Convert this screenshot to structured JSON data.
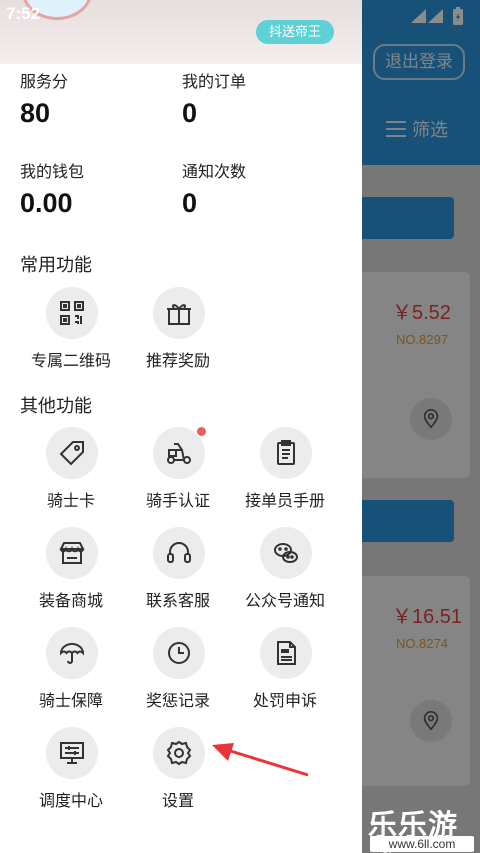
{
  "status_bar": {
    "time": "7:52"
  },
  "background": {
    "logout_label": "退出登录",
    "filter_label": "筛选",
    "orders": [
      {
        "price": "￥5.52",
        "order_no": "NO.8297"
      },
      {
        "price": "￥16.51",
        "order_no": "NO.8274"
      }
    ]
  },
  "drawer": {
    "badge": "抖送帝王",
    "stats": [
      {
        "label": "服务分",
        "value": "80"
      },
      {
        "label": "我的订单",
        "value": "0"
      },
      {
        "label": "我的钱包",
        "value": "0.00"
      },
      {
        "label": "通知次数",
        "value": "0"
      }
    ],
    "common_title": "常用功能",
    "common": [
      {
        "label": "专属二维码",
        "icon": "qr-code-icon"
      },
      {
        "label": "推荐奖励",
        "icon": "gift-icon"
      }
    ],
    "other_title": "其他功能",
    "other": [
      {
        "label": "骑士卡",
        "icon": "tag-icon"
      },
      {
        "label": "骑手认证",
        "icon": "scooter-icon",
        "dot": true
      },
      {
        "label": "接单员手册",
        "icon": "manual-icon"
      },
      {
        "label": "装备商城",
        "icon": "store-icon"
      },
      {
        "label": "联系客服",
        "icon": "headset-icon"
      },
      {
        "label": "公众号通知",
        "icon": "wechat-icon"
      },
      {
        "label": "骑士保障",
        "icon": "umbrella-icon"
      },
      {
        "label": "奖惩记录",
        "icon": "clock-icon"
      },
      {
        "label": "处罚申诉",
        "icon": "penalty-doc-icon"
      },
      {
        "label": "调度中心",
        "icon": "dispatch-monitor-icon"
      },
      {
        "label": "设置",
        "icon": "settings-gear-icon"
      }
    ]
  },
  "watermark": {
    "title": "乐乐游戏",
    "url": "www.6ll.com"
  },
  "colors": {
    "primary": "#2d94d9",
    "price": "#e04141",
    "badge": "#5fd0d6",
    "dot": "#ef5a5a"
  }
}
